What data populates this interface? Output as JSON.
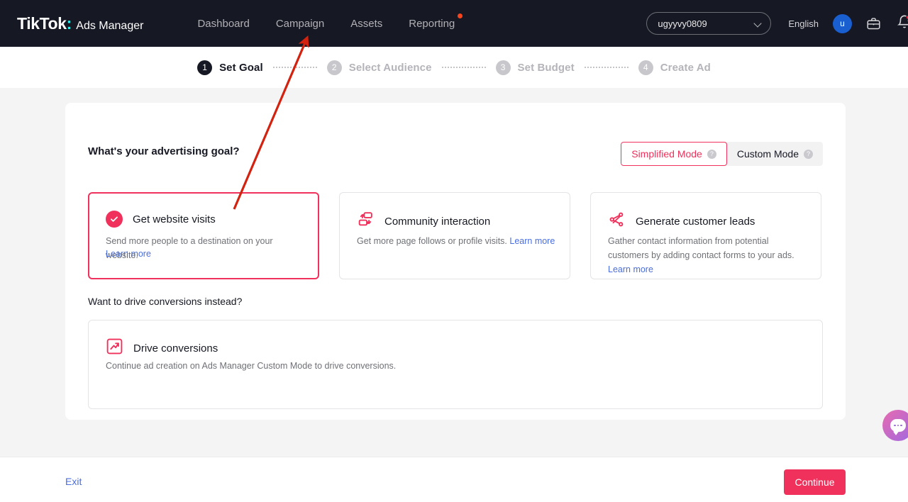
{
  "header": {
    "logo_main": "TikTok",
    "logo_colon": ":",
    "logo_sub": "Ads Manager",
    "nav": [
      {
        "label": "Dashboard",
        "badge": false
      },
      {
        "label": "Campaign",
        "badge": false
      },
      {
        "label": "Assets",
        "badge": false
      },
      {
        "label": "Reporting",
        "badge": true
      }
    ],
    "account": "ugyyvy0809",
    "language": "English",
    "avatar_initial": "u",
    "icons": [
      "briefcase-icon",
      "bell-icon"
    ]
  },
  "stepper": {
    "steps": [
      {
        "num": "1",
        "label": "Set Goal",
        "state": "active"
      },
      {
        "num": "2",
        "label": "Select Audience",
        "state": "inactive"
      },
      {
        "num": "3",
        "label": "Set Budget",
        "state": "inactive"
      },
      {
        "num": "4",
        "label": "Create Ad",
        "state": "inactive"
      }
    ]
  },
  "main": {
    "title": "What's your advertising goal?",
    "mode_toggle": {
      "simplified": "Simplified Mode",
      "custom": "Custom Mode",
      "help_glyph": "?"
    },
    "goals": [
      {
        "id": "website-visits",
        "title": "Get website visits",
        "desc": "Send more people to a destination on your website.",
        "learn_more": "Learn more",
        "icon": "check-circle-icon",
        "selected": true
      },
      {
        "id": "community-interaction",
        "title": "Community interaction",
        "desc": "Get more page follows or profile visits.",
        "learn_more": "Learn more",
        "icon": "community-interaction-icon",
        "selected": false
      },
      {
        "id": "customer-leads",
        "title": "Generate customer leads",
        "desc": "Gather contact information from potential customers by adding contact forms to your ads.",
        "learn_more": "Learn more",
        "icon": "leads-network-icon",
        "selected": false
      }
    ],
    "conversions": {
      "heading": "Want to drive conversions instead?",
      "title": "Drive conversions",
      "desc": "Continue ad creation on Ads Manager Custom Mode to drive conversions.",
      "icon": "trending-up-icon"
    }
  },
  "footer": {
    "exit": "Exit",
    "continue": "Continue"
  },
  "widgets": {
    "chat": "chat-bubble-icon"
  },
  "colors": {
    "brand_pink": "#f0315b",
    "link_blue": "#4a6ee0",
    "header_bg": "#161823",
    "page_bg": "#f4f4f5",
    "annotation_red": "#d32310"
  }
}
